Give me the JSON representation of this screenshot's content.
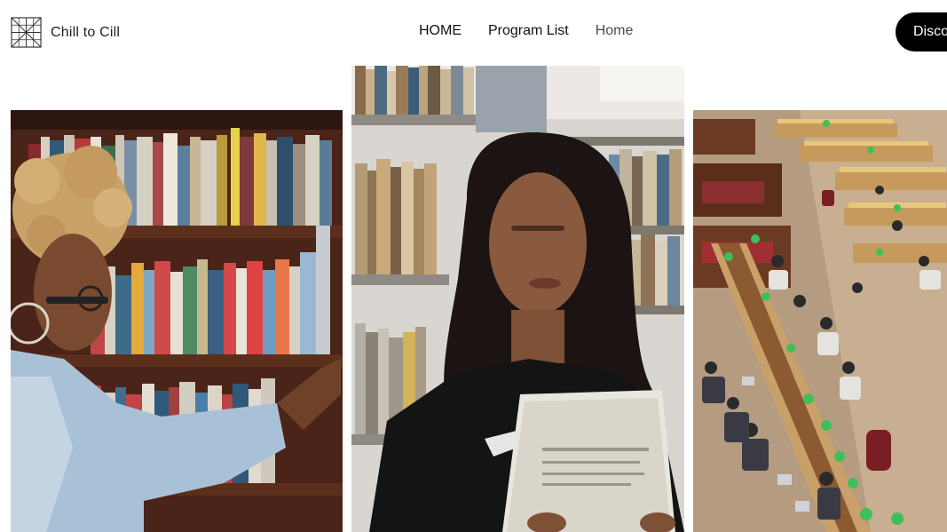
{
  "header": {
    "brand": "Chill to Cill",
    "logo_icon": "grid-logo-icon",
    "nav": [
      "HOME",
      "Program List",
      "Home"
    ],
    "cta_label": "Disco"
  },
  "photos": [
    {
      "id": "p1",
      "subject": "student-reaching-bookshelf-photo"
    },
    {
      "id": "p2",
      "subject": "student-reading-book-photo"
    },
    {
      "id": "p3",
      "subject": "library-reading-room-photo"
    }
  ]
}
